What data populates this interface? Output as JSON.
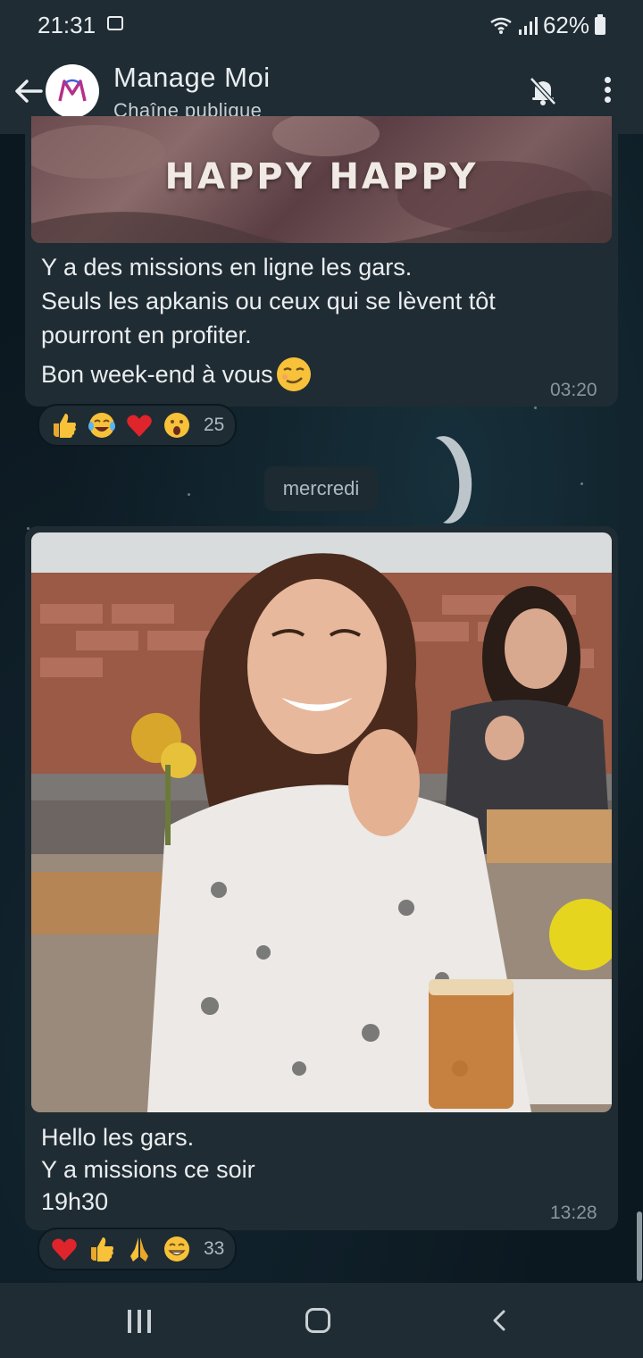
{
  "status_bar": {
    "time": "21:31",
    "battery": "62%"
  },
  "header": {
    "title": "Manage Moi",
    "subtitle": "Chaîne publique",
    "avatar_letter": "M"
  },
  "messages": [
    {
      "image_caption": "HAPPY HAPPY",
      "text_lines": [
        "Y a des missions en ligne les gars.",
        "Seuls les apkanis ou ceux qui se lèvent tôt",
        "pourront en profiter.",
        "Bon week-end à vous"
      ],
      "time": "03:20",
      "reactions": {
        "emojis": [
          "thumbs-up",
          "joy",
          "red-heart",
          "open-mouth"
        ],
        "count": "25"
      }
    },
    {
      "text_lines": [
        "Hello les gars.",
        "Y a missions ce soir",
        "19h30"
      ],
      "time": "13:28",
      "reactions": {
        "emojis": [
          "red-heart",
          "thumbs-up",
          "folded-hands",
          "grinning"
        ],
        "count": "33"
      }
    }
  ],
  "date_separator": "mercredi"
}
